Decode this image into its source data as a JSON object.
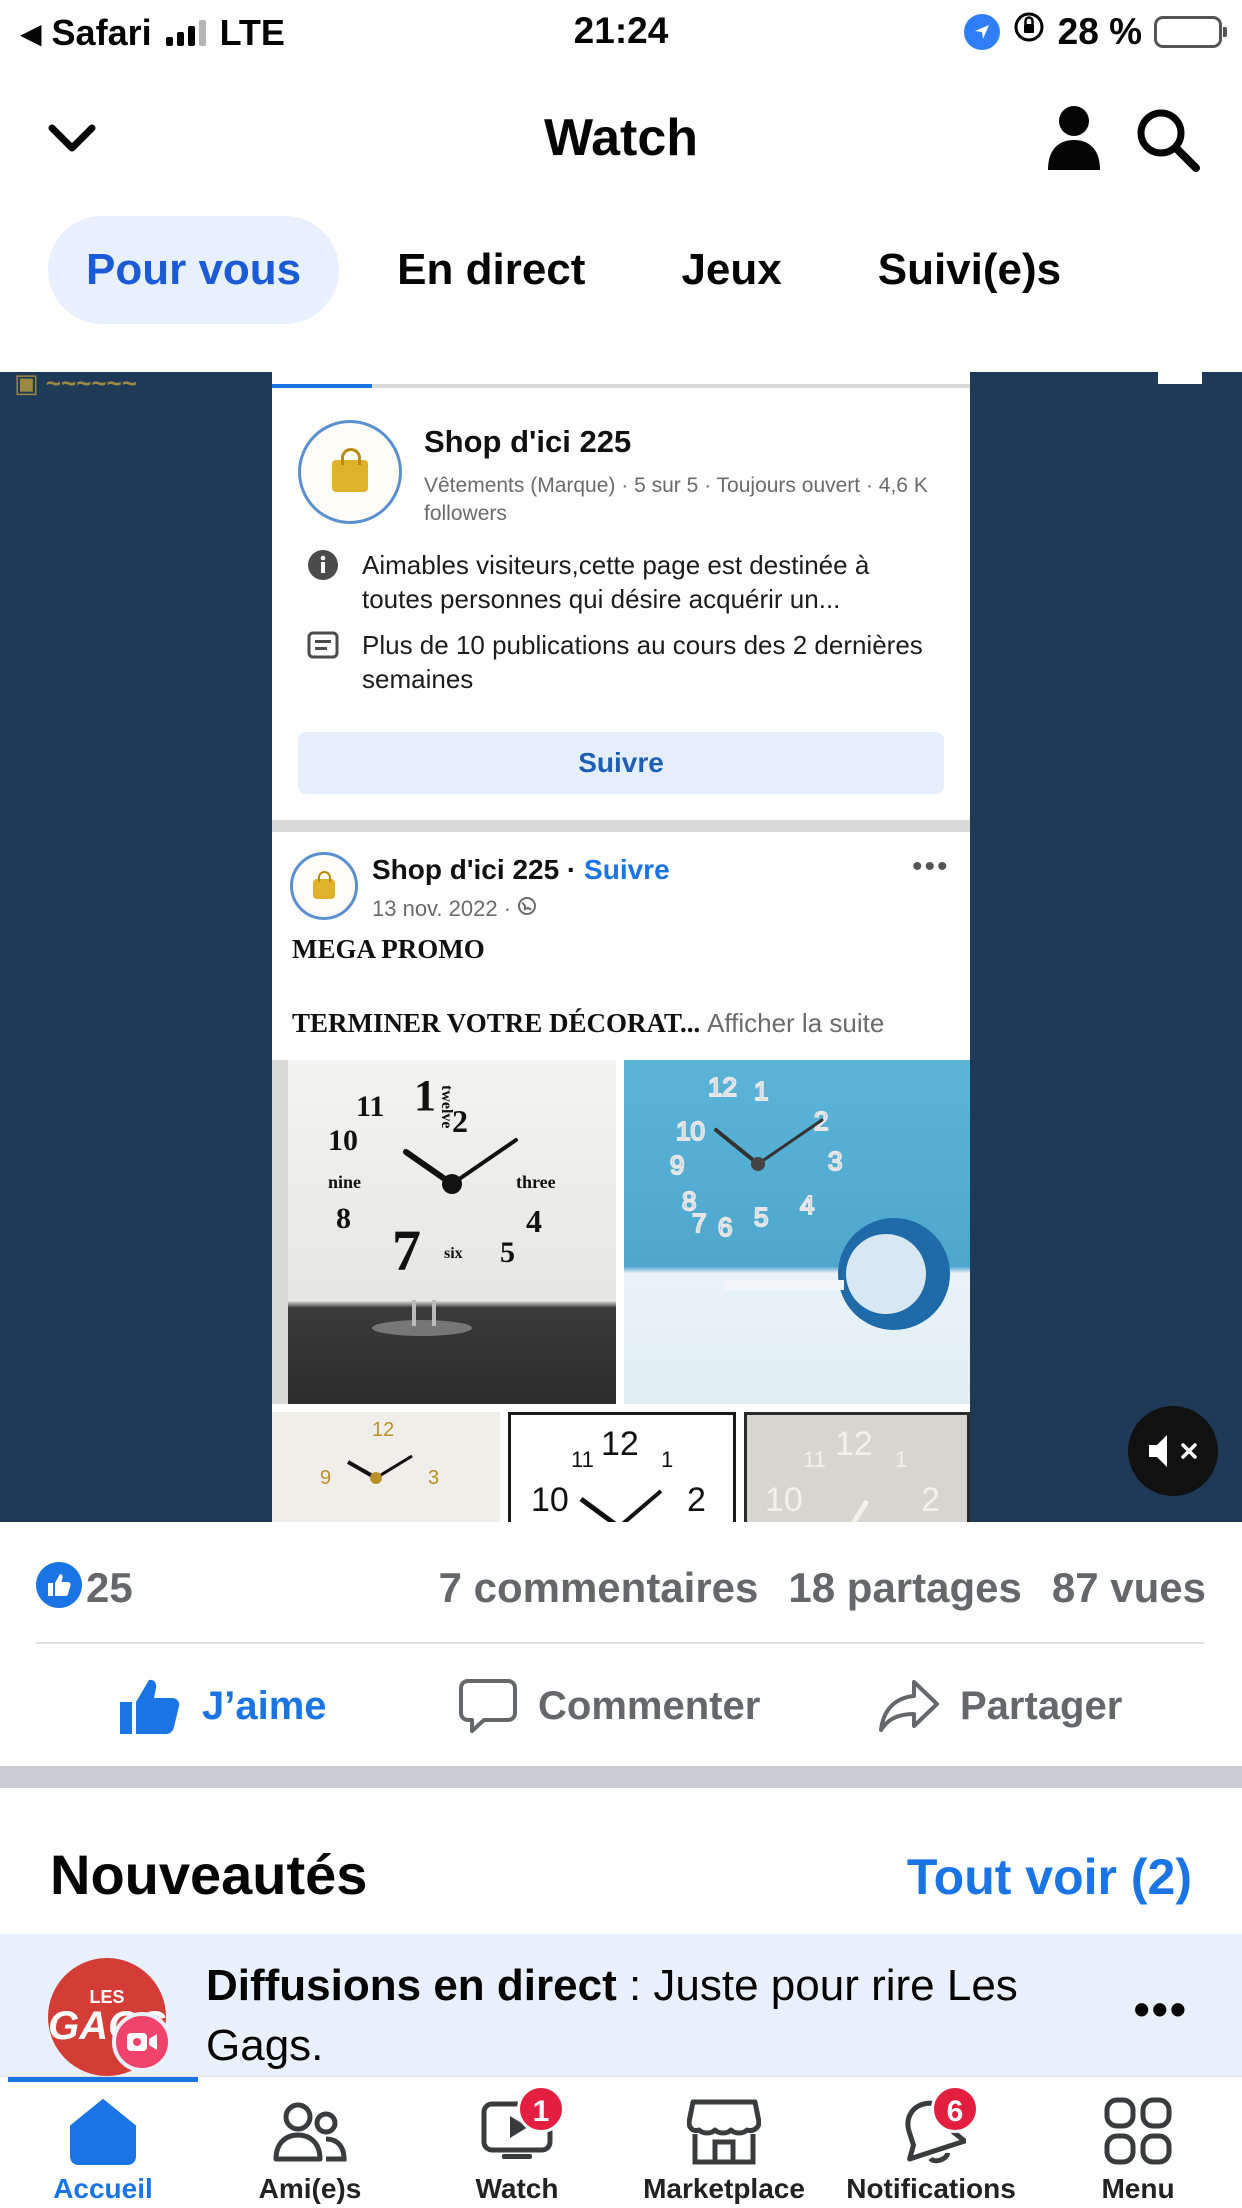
{
  "status_bar": {
    "back_app": "Safari",
    "network": "LTE",
    "time": "21:24",
    "battery": "28 %",
    "battery_level": 0.28
  },
  "header": {
    "title": "Watch"
  },
  "tabs": [
    {
      "label": "Pour vous",
      "active": true
    },
    {
      "label": "En direct",
      "active": false
    },
    {
      "label": "Jeux",
      "active": false
    },
    {
      "label": "Suivi(e)s",
      "active": false
    }
  ],
  "video": {
    "page_card": {
      "name": "Shop d'ici 225",
      "meta": "Vêtements (Marque) · 5 sur 5 · Toujours ouvert · 4,6 K followers",
      "info_1": "Aimables visiteurs,cette page est destinée à toutes personnes qui désire acquérir un...",
      "info_2": "Plus de 10 publications au cours des 2 dernières semaines",
      "follow_label": "Suivre"
    },
    "post": {
      "author": "Shop d'ici 225",
      "follow": "Suivre",
      "date": "13 nov. 2022 ·",
      "line_1": "MEGA PROMO",
      "line_2": "TERMINER VOTRE DÉCORAT...",
      "see_more": "Afficher la suite"
    }
  },
  "stats": {
    "likes": "25",
    "comments": "7 commentaires",
    "shares": "18 partages",
    "views": "87 vues"
  },
  "actions": {
    "like": "J’aime",
    "comment": "Commenter",
    "share": "Partager"
  },
  "news": {
    "title": "Nouveautés",
    "see_all": "Tout voir (2)",
    "item": {
      "highlight": "Diffusions en direct",
      "text": " : Juste pour rire Les Gags.",
      "avatar_top": "LES",
      "avatar_main": "GAGS"
    }
  },
  "bottom_nav": [
    {
      "label": "Accueil",
      "active": true,
      "badge": ""
    },
    {
      "label": "Ami(e)s",
      "active": false,
      "badge": ""
    },
    {
      "label": "Watch",
      "active": false,
      "badge": "1"
    },
    {
      "label": "Marketplace",
      "active": false,
      "badge": ""
    },
    {
      "label": "Notifications",
      "active": false,
      "badge": "6"
    },
    {
      "label": "Menu",
      "active": false,
      "badge": ""
    }
  ],
  "colors": {
    "accent": "#1b74e4",
    "video_bg": "#1e3a57",
    "badge": "#e41e3f"
  }
}
